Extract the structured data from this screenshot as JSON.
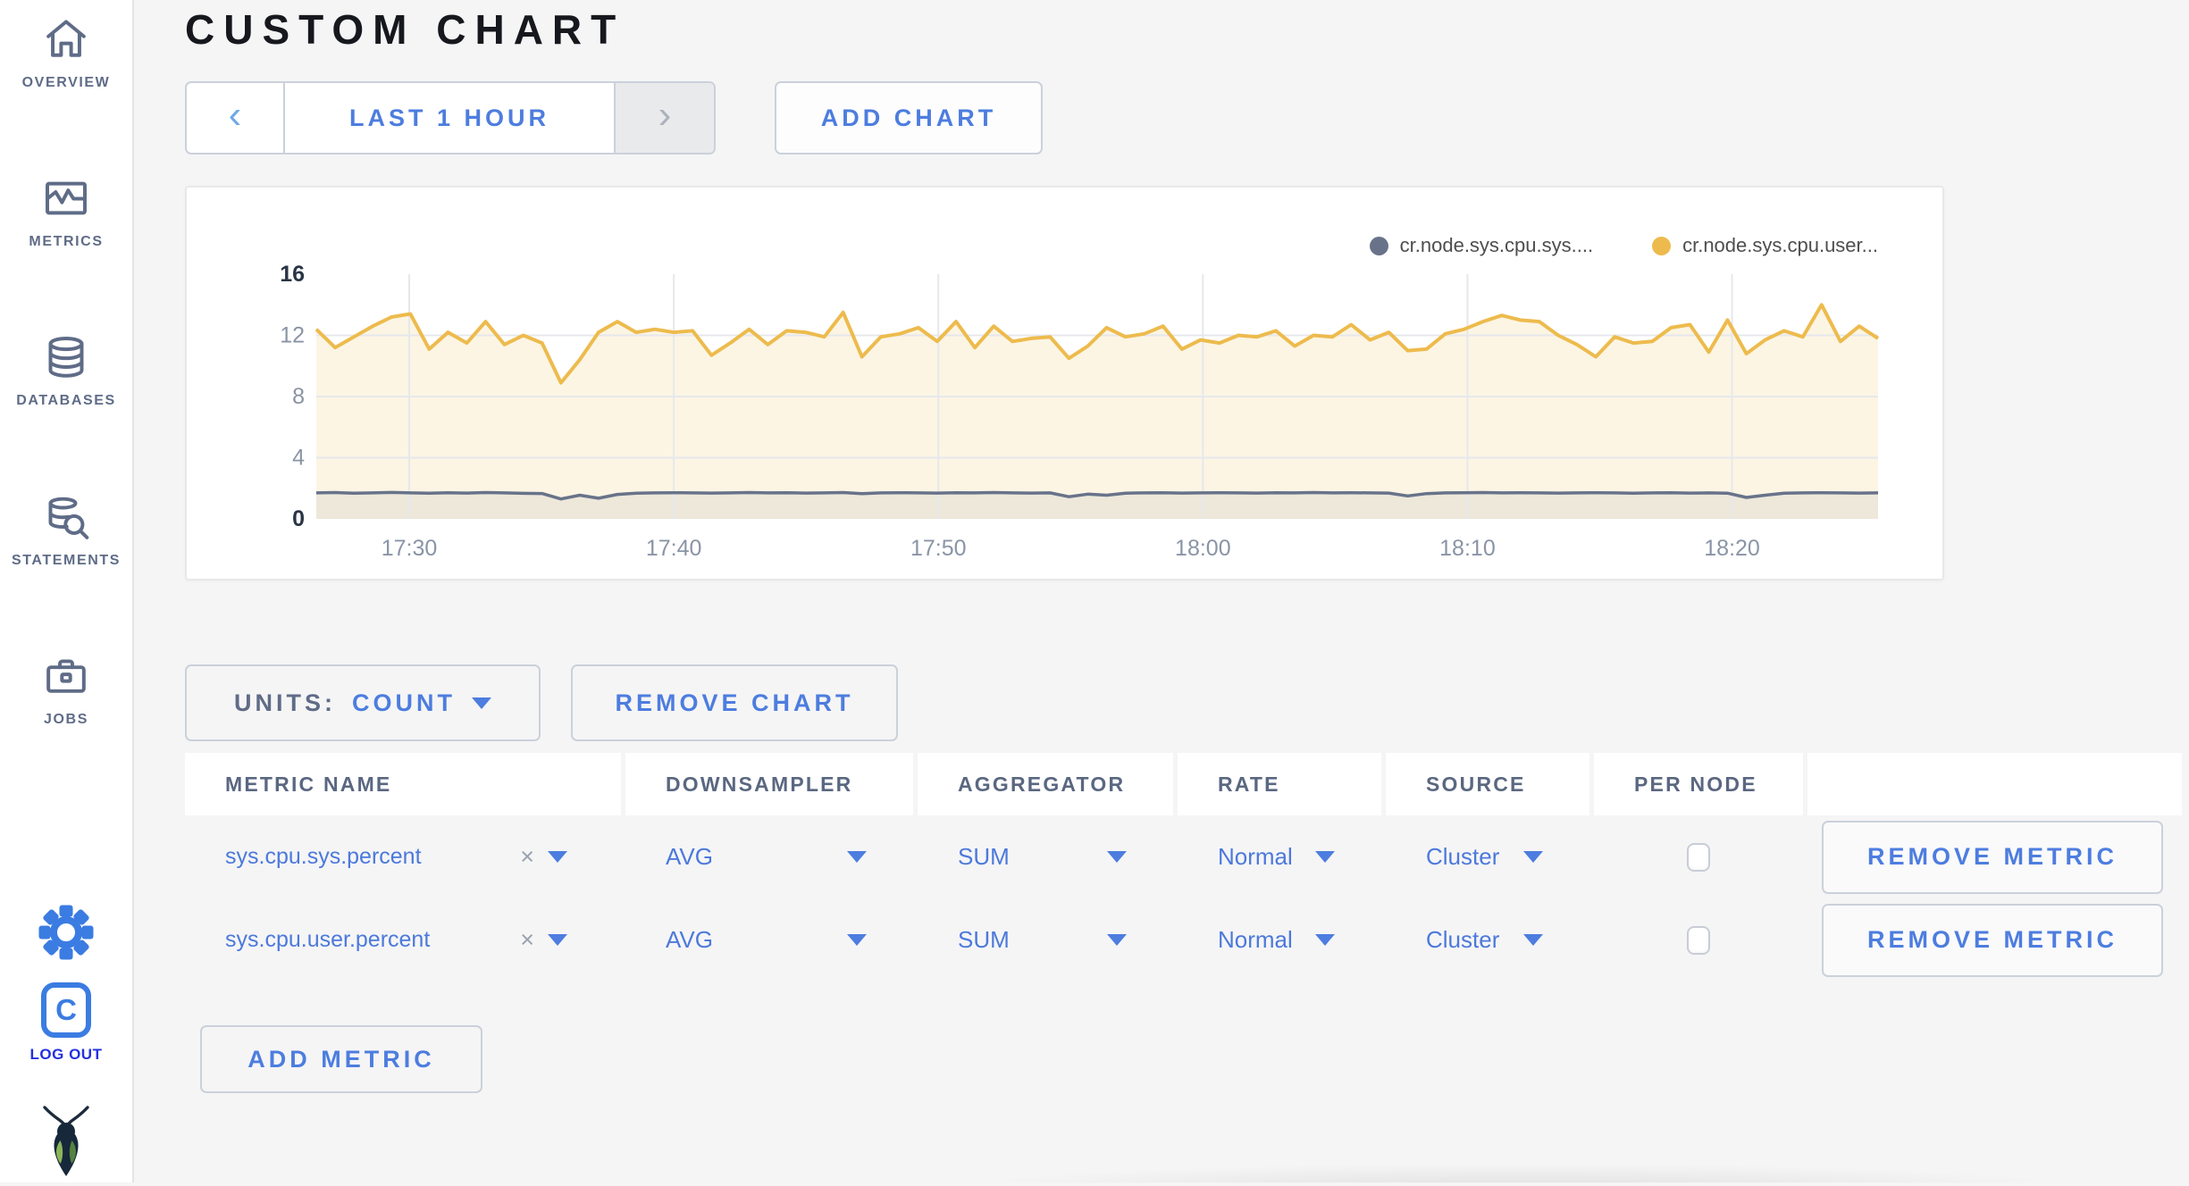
{
  "sidebar": {
    "items": [
      {
        "label": "OVERVIEW",
        "icon": "home-icon"
      },
      {
        "label": "METRICS",
        "icon": "metrics-icon"
      },
      {
        "label": "DATABASES",
        "icon": "database-icon"
      },
      {
        "label": "STATEMENTS",
        "icon": "statements-icon"
      },
      {
        "label": "JOBS",
        "icon": "jobs-icon"
      }
    ],
    "logout": {
      "letter": "C",
      "label": "LOG OUT"
    }
  },
  "header": {
    "title": "CUSTOM CHART"
  },
  "toolbar": {
    "prev_arrow": "‹",
    "time_range": "LAST 1 HOUR",
    "next_arrow": "›",
    "add_chart": "ADD CHART"
  },
  "chart_data": {
    "type": "area",
    "title": "",
    "xlabel": "",
    "ylabel": "",
    "ylim": [
      0,
      16
    ],
    "y_ticks": [
      0,
      4,
      8,
      12,
      16
    ],
    "x_window": {
      "start": "17:25",
      "end": "18:25"
    },
    "x_ticks": [
      {
        "label": "17:30",
        "f": 0.0595
      },
      {
        "label": "17:40",
        "f": 0.2289
      },
      {
        "label": "17:50",
        "f": 0.3983
      },
      {
        "label": "18:00",
        "f": 0.5677
      },
      {
        "label": "18:10",
        "f": 0.7371
      },
      {
        "label": "18:20",
        "f": 0.9065
      }
    ],
    "grid": true,
    "legend_position": "top-right",
    "series": [
      {
        "name": "cr.node.sys.cpu.sys....",
        "color": "#68738A",
        "fill": "rgba(104,115,138,0.10)",
        "values": [
          1.7,
          1.72,
          1.68,
          1.7,
          1.73,
          1.7,
          1.68,
          1.71,
          1.69,
          1.72,
          1.7,
          1.67,
          1.66,
          1.3,
          1.55,
          1.35,
          1.6,
          1.68,
          1.7,
          1.71,
          1.7,
          1.69,
          1.7,
          1.72,
          1.7,
          1.71,
          1.69,
          1.7,
          1.72,
          1.65,
          1.7,
          1.71,
          1.7,
          1.69,
          1.71,
          1.7,
          1.72,
          1.7,
          1.69,
          1.7,
          1.45,
          1.62,
          1.55,
          1.68,
          1.7,
          1.71,
          1.69,
          1.7,
          1.71,
          1.7,
          1.69,
          1.71,
          1.7,
          1.72,
          1.7,
          1.71,
          1.7,
          1.69,
          1.5,
          1.65,
          1.7,
          1.71,
          1.72,
          1.7,
          1.71,
          1.7,
          1.69,
          1.7,
          1.71,
          1.7,
          1.68,
          1.7,
          1.71,
          1.69,
          1.7,
          1.68,
          1.4,
          1.55,
          1.68,
          1.7,
          1.71,
          1.7,
          1.69,
          1.7
        ]
      },
      {
        "name": "cr.node.sys.cpu.user...",
        "color": "#EDBB4D",
        "fill": "rgba(237,187,77,0.15)",
        "values": [
          12.4,
          11.2,
          11.9,
          12.6,
          13.2,
          13.4,
          11.1,
          12.2,
          11.5,
          12.9,
          11.4,
          12.0,
          11.5,
          8.9,
          10.4,
          12.2,
          12.9,
          12.2,
          12.4,
          12.2,
          12.3,
          10.7,
          11.5,
          12.4,
          11.4,
          12.3,
          12.2,
          11.9,
          13.5,
          10.6,
          11.9,
          12.1,
          12.5,
          11.6,
          12.9,
          11.2,
          12.6,
          11.6,
          11.8,
          11.9,
          10.5,
          11.3,
          12.5,
          11.9,
          12.1,
          12.6,
          11.1,
          11.7,
          11.5,
          12.0,
          11.9,
          12.3,
          11.3,
          12.0,
          11.9,
          12.7,
          11.7,
          12.2,
          11.0,
          11.1,
          12.1,
          12.4,
          12.9,
          13.3,
          13.0,
          12.9,
          12.0,
          11.4,
          10.6,
          11.9,
          11.5,
          11.6,
          12.5,
          12.7,
          10.9,
          13.0,
          10.8,
          11.7,
          12.3,
          11.9,
          14.0,
          11.6,
          12.6,
          11.8
        ]
      }
    ]
  },
  "units": {
    "label": "UNITS:",
    "value": "COUNT"
  },
  "actions": {
    "remove_chart": "REMOVE CHART",
    "remove_metric": "REMOVE METRIC",
    "add_metric": "ADD METRIC"
  },
  "table": {
    "headers": [
      "METRIC NAME",
      "DOWNSAMPLER",
      "AGGREGATOR",
      "RATE",
      "SOURCE",
      "PER NODE",
      ""
    ],
    "clear_glyph": "×",
    "rows": [
      {
        "metric": "sys.cpu.sys.percent",
        "downsampler": "AVG",
        "aggregator": "SUM",
        "rate": "Normal",
        "source": "Cluster",
        "per_node_checked": false
      },
      {
        "metric": "sys.cpu.user.percent",
        "downsampler": "AVG",
        "aggregator": "SUM",
        "rate": "Normal",
        "source": "Cluster",
        "per_node_checked": false
      }
    ]
  },
  "colors": {
    "accent_blue": "#4D7DDF",
    "slate": "#5F6C87",
    "axis_bold": "#2A3447",
    "axis_muted": "#8A94A6",
    "gridline": "#E6E8EC"
  }
}
